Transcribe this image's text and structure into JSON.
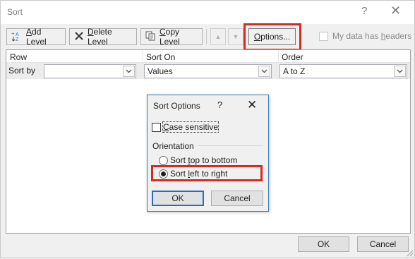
{
  "window": {
    "title": "Sort",
    "help": "?",
    "close": "✕"
  },
  "toolbar": {
    "add_level": {
      "mnemonic": "A",
      "rest": "dd Level"
    },
    "delete_level": {
      "mnemonic": "D",
      "rest": "elete Level"
    },
    "copy_level": {
      "mnemonic": "C",
      "rest": "opy Level"
    },
    "move_up": "▲",
    "move_down": "▼",
    "options": {
      "mnemonic": "O",
      "rest": "ptions..."
    },
    "headers_checkbox": {
      "label_pre": "My data has ",
      "mnemonic": "h",
      "label_post": "eaders",
      "checked": false
    }
  },
  "grid": {
    "headers": {
      "row": "Row",
      "sort_on": "Sort On",
      "order": "Order"
    },
    "row_label": "Sort by",
    "row_value": "",
    "sort_on_value": "Values",
    "order_value": "A to Z"
  },
  "sort_options": {
    "title": "Sort Options",
    "help": "?",
    "close": "✕",
    "case_sensitive": {
      "mnemonic": "C",
      "rest": "ase sensitive",
      "checked": false
    },
    "orientation_label": "Orientation",
    "top_to_bottom": {
      "pre": "Sort ",
      "mnemonic": "t",
      "post": "op to bottom",
      "selected": false
    },
    "left_to_right": {
      "pre": "Sort ",
      "mnemonic": "l",
      "post": "eft to right",
      "selected": true
    },
    "ok": "OK",
    "cancel": "Cancel"
  },
  "footer": {
    "ok": "OK",
    "cancel": "Cancel"
  },
  "colors": {
    "highlight": "#d42a1f",
    "dialog_border": "#3c7fb1"
  }
}
